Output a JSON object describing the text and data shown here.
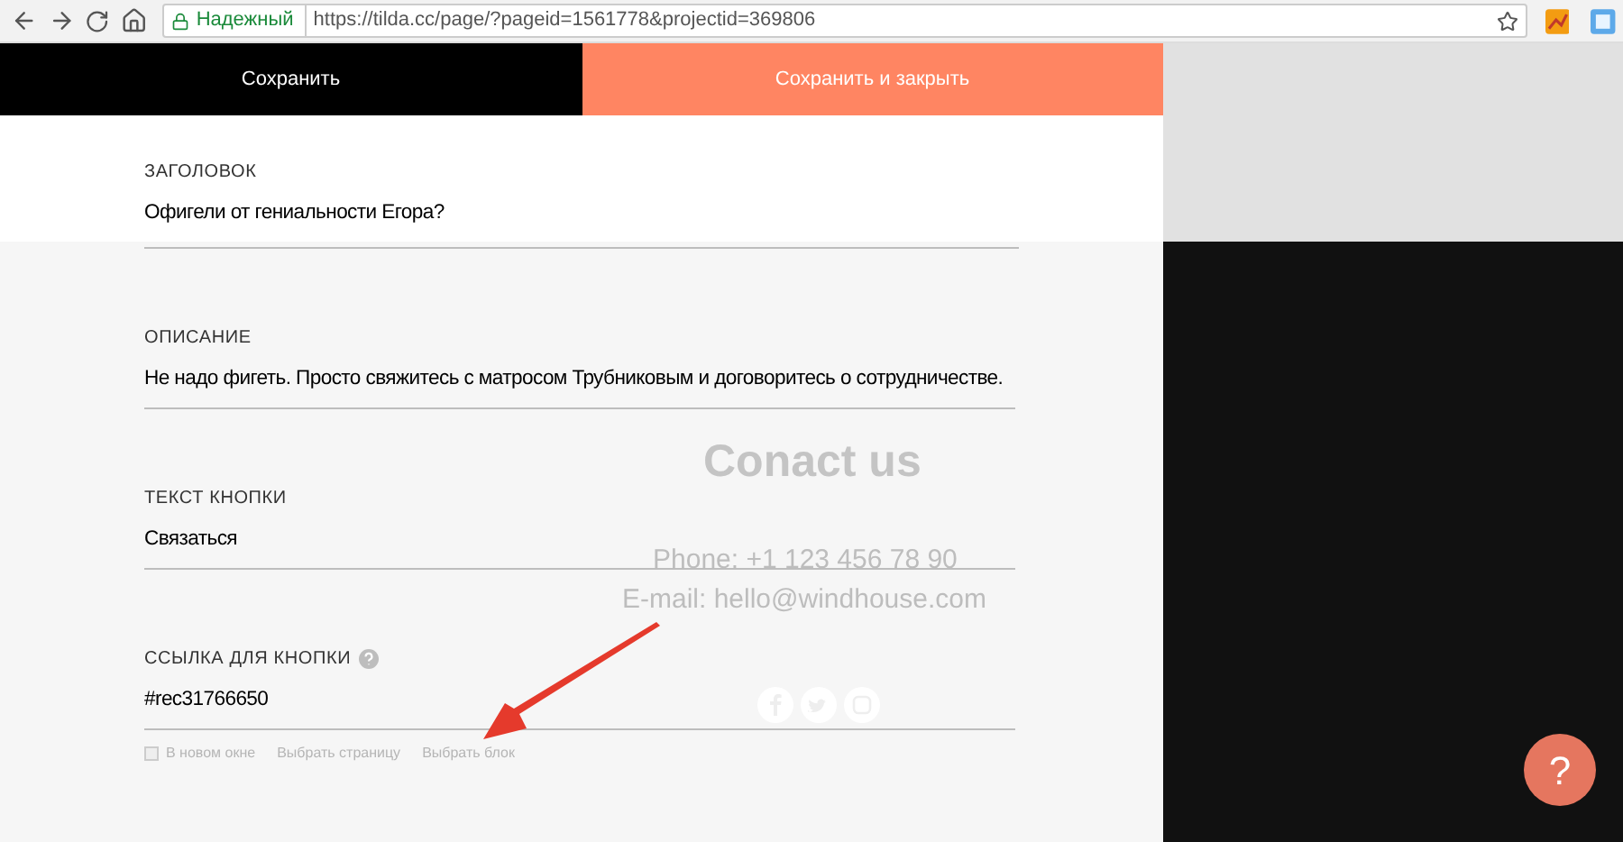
{
  "browser": {
    "secure_label": "Надежный",
    "url": "https://tilda.cc/page/?pageid=1561778&projectid=369806"
  },
  "actions": [
    {
      "label": "Сохранить",
      "kind": "primary"
    },
    {
      "label": "Сохранить и закрыть",
      "kind": "accent"
    }
  ],
  "fields": [
    {
      "label": "ЗАГОЛОВОК",
      "value": "Офигели от гениальности Егора?",
      "help": false
    },
    {
      "label": "ОПИСАНИЕ",
      "value": "Не надо фигеть. Просто свяжитесь с матросом Трубниковым и договоритесь о сотрудничестве.",
      "help": false
    },
    {
      "label": "ТЕКСТ КНОПКИ",
      "value": "Связаться",
      "help": false
    },
    {
      "label": "ССЫЛКА ДЛЯ КНОПКИ",
      "value": "#rec31766650",
      "help": true
    }
  ],
  "link_options": {
    "new_window": {
      "label": "В новом окне",
      "checked": false
    },
    "links": [
      "Выбрать страницу",
      "Выбрать блок"
    ]
  },
  "preview": {
    "title": "Conact us",
    "phone": "Phone: +1 123 456 78 90",
    "email": "E-mail: hello@windhouse.com"
  },
  "help_button": {
    "label": "?"
  }
}
